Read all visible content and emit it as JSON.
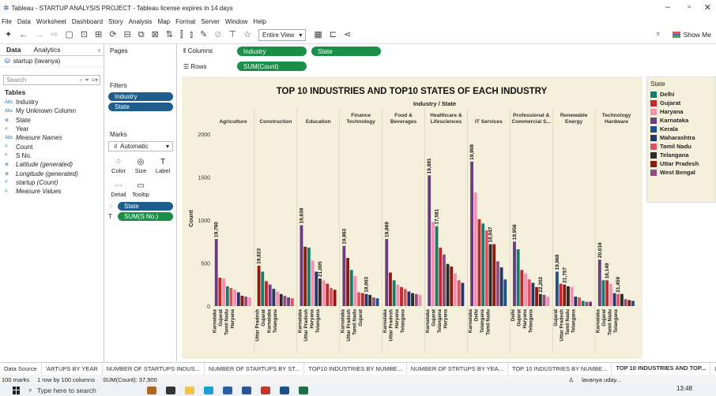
{
  "window": {
    "title": "Tableau - STARTUP ANALYSIS PROJECT - Tableau license expires in 14 days"
  },
  "menu": [
    "File",
    "Data",
    "Worksheet",
    "Dashboard",
    "Story",
    "Analysis",
    "Map",
    "Format",
    "Server",
    "Window",
    "Help"
  ],
  "toolbar": {
    "view_select": "Entire View",
    "show_me": "Show Me"
  },
  "left": {
    "tab_data": "Data",
    "tab_analytics": "Analytics",
    "datasource": "startup (lavanya)",
    "search_placeholder": "Search",
    "tables_header": "Tables",
    "fields": [
      {
        "label": "Industry",
        "kind": "Abc"
      },
      {
        "label": "My Unknown Column",
        "kind": "Abc"
      },
      {
        "label": "State",
        "kind": "geo"
      },
      {
        "label": "Year",
        "kind": "#"
      },
      {
        "label": "Measure Names",
        "kind": "Abc"
      },
      {
        "label": "Count",
        "kind": "#"
      },
      {
        "label": "S No.",
        "kind": "#"
      },
      {
        "label": "Latitude (generated)",
        "kind": "geo"
      },
      {
        "label": "Longitude (generated)",
        "kind": "geo"
      },
      {
        "label": "startup (Count)",
        "kind": "#"
      },
      {
        "label": "Measure Values",
        "kind": "#"
      }
    ]
  },
  "pages": {
    "header": "Pages",
    "filters_header": "Filters",
    "filters": [
      "Industry",
      "State"
    ],
    "marks_header": "Marks",
    "mark_type": "Automatic",
    "mark_buttons": [
      "Color",
      "Size",
      "Label",
      "Detail",
      "Tooltip"
    ],
    "mark_pills": [
      "State",
      "SUM(S No.)"
    ]
  },
  "shelves": {
    "columns_label": "Columns",
    "rows_label": "Rows",
    "columns": [
      "Industry",
      "State"
    ],
    "rows": [
      "SUM(Count)"
    ]
  },
  "legend": {
    "title": "State",
    "items": [
      {
        "label": "Delhi",
        "color": "#1a7a6a"
      },
      {
        "label": "Gujarat",
        "color": "#c1272d"
      },
      {
        "label": "Haryana",
        "color": "#f48fb1"
      },
      {
        "label": "Karnataka",
        "color": "#6a3d7f"
      },
      {
        "label": "Kerala",
        "color": "#1f4e8c"
      },
      {
        "label": "Maharashtra",
        "color": "#23376b"
      },
      {
        "label": "Tamil Nadu",
        "color": "#e05263"
      },
      {
        "label": "Telangana",
        "color": "#2b2b2b"
      },
      {
        "label": "Uttar Pradesh",
        "color": "#8c1c13"
      },
      {
        "label": "West Bengal",
        "color": "#8e4f80"
      }
    ]
  },
  "chart_data": {
    "type": "bar",
    "title": "TOP 10 INDUSTRIES AND TOP10 STATES OF EACH INDUSTRY",
    "column_header": "Industry / State",
    "ylabel": "Count",
    "ylim": [
      0,
      2000
    ],
    "yticks": [
      0,
      500,
      1000,
      1500,
      2000
    ],
    "series": [
      {
        "industry": "Agriculture",
        "bars": [
          {
            "state": "Karnataka",
            "value": 780,
            "label": "19,760"
          },
          {
            "state": "Gujarat",
            "value": 330
          },
          {
            "state": "Haryana",
            "value": 320
          },
          {
            "state": "Delhi",
            "value": 230
          },
          {
            "state": "Tamil Nadu",
            "value": 210
          },
          {
            "state": "Haryana",
            "value": 190
          },
          {
            "state": "Maharashtra",
            "value": 160
          },
          {
            "state": "Uttar Pradesh",
            "value": 120
          },
          {
            "state": "West Bengal",
            "value": 110
          },
          {
            "state": "Haryana",
            "value": 100
          }
        ]
      },
      {
        "industry": "Construction",
        "bars": [
          {
            "state": "Uttar Pradesh",
            "value": 470,
            "label": "19,823"
          },
          {
            "state": "Delhi",
            "value": 400
          },
          {
            "state": "Gujarat",
            "value": 290
          },
          {
            "state": "Karnataka",
            "value": 250
          },
          {
            "state": "Maharashtra",
            "value": 200
          },
          {
            "state": "Haryana",
            "value": 170
          },
          {
            "state": "Telangana",
            "value": 140
          },
          {
            "state": "West Bengal",
            "value": 120
          },
          {
            "state": "Karnataka",
            "value": 100
          },
          {
            "state": "Tamil Nadu",
            "value": 90
          }
        ]
      },
      {
        "industry": "Education",
        "bars": [
          {
            "state": "Karnataka",
            "value": 940,
            "label": "19,839"
          },
          {
            "state": "Uttar Pradesh",
            "value": 690
          },
          {
            "state": "Delhi",
            "value": 680
          },
          {
            "state": "Haryana",
            "value": 530
          },
          {
            "state": "Maharashtra",
            "value": 400
          },
          {
            "state": "Telangana",
            "value": 320,
            "label": "21,005"
          },
          {
            "state": "Haryana",
            "value": 300
          },
          {
            "state": "Gujarat",
            "value": 260
          },
          {
            "state": "Tamil Nadu",
            "value": 210
          },
          {
            "state": "Uttar Pradesh",
            "value": 190
          }
        ]
      },
      {
        "industry": "Finance Technology",
        "bars": [
          {
            "state": "Karnataka",
            "value": 700,
            "label": "19,863"
          },
          {
            "state": "Uttar Pradesh",
            "value": 560
          },
          {
            "state": "Delhi",
            "value": 420
          },
          {
            "state": "Haryana",
            "value": 350
          },
          {
            "state": "Tamil Nadu",
            "value": 160
          },
          {
            "state": "Gujarat",
            "value": 150
          },
          {
            "state": "Maharashtra",
            "value": 140,
            "label": "18,003"
          },
          {
            "state": "Telangana",
            "value": 130
          },
          {
            "state": "West Bengal",
            "value": 100
          },
          {
            "state": "Kerala",
            "value": 90
          }
        ]
      },
      {
        "industry": "Food & Beverages",
        "bars": [
          {
            "state": "Karnataka",
            "value": 780,
            "label": "19,869"
          },
          {
            "state": "Uttar Pradesh",
            "value": 390
          },
          {
            "state": "Delhi",
            "value": 300
          },
          {
            "state": "Haryana",
            "value": 250
          },
          {
            "state": "Gujarat",
            "value": 220
          },
          {
            "state": "Tamil Nadu",
            "value": 200
          },
          {
            "state": "Maharashtra",
            "value": 170
          },
          {
            "state": "Telangana",
            "value": 150
          },
          {
            "state": "West Bengal",
            "value": 140
          },
          {
            "state": "Haryana",
            "value": 130
          }
        ]
      },
      {
        "industry": "Healthcare & Lifesciences",
        "bars": [
          {
            "state": "Karnataka",
            "value": 1520,
            "label": "19,881"
          },
          {
            "state": "Haryana",
            "value": 980
          },
          {
            "state": "Delhi",
            "value": 930,
            "label": "17,581"
          },
          {
            "state": "Gujarat",
            "value": 680
          },
          {
            "state": "West Bengal",
            "value": 600
          },
          {
            "state": "Telangana",
            "value": 490
          },
          {
            "state": "Uttar Pradesh",
            "value": 460
          },
          {
            "state": "Haryana",
            "value": 380
          },
          {
            "state": "Tamil Nadu",
            "value": 300
          },
          {
            "state": "Maharashtra",
            "value": 270
          }
        ]
      },
      {
        "industry": "IT Services",
        "bars": [
          {
            "state": "Karnataka",
            "value": 1680,
            "label": "19,908"
          },
          {
            "state": "Haryana",
            "value": 1320
          },
          {
            "state": "Gujarat",
            "value": 1010
          },
          {
            "state": "Delhi",
            "value": 960
          },
          {
            "state": "Tamil Nadu",
            "value": 880
          },
          {
            "state": "Telangana",
            "value": 720,
            "label": "18,047"
          },
          {
            "state": "Uttar Pradesh",
            "value": 720
          },
          {
            "state": "West Bengal",
            "value": 520
          },
          {
            "state": "Maharashtra",
            "value": 450
          },
          {
            "state": "Kerala",
            "value": 310
          }
        ]
      },
      {
        "industry": "Professional & Commercial S...",
        "bars": [
          {
            "state": "Karnataka",
            "value": 750,
            "label": "19,956"
          },
          {
            "state": "Delhi",
            "value": 660
          },
          {
            "state": "Gujarat",
            "value": 420
          },
          {
            "state": "Haryana",
            "value": 380
          },
          {
            "state": "Tamil Nadu",
            "value": 310
          },
          {
            "state": "Maharashtra",
            "value": 270
          },
          {
            "state": "Uttar Pradesh",
            "value": 220
          },
          {
            "state": "Telangana",
            "value": 140,
            "label": "22,202"
          },
          {
            "state": "West Bengal",
            "value": 130
          },
          {
            "state": "Haryana",
            "value": 110
          }
        ]
      },
      {
        "industry": "Renewable Energy",
        "bars": [
          {
            "state": "Kerala",
            "value": 400,
            "label": "19,968"
          },
          {
            "state": "Gujarat",
            "value": 260
          },
          {
            "state": "Uttar Pradesh",
            "value": 250,
            "label": "21,757"
          },
          {
            "state": "Telangana",
            "value": 230
          },
          {
            "state": "Haryana",
            "value": 220
          },
          {
            "state": "Maharashtra",
            "value": 110
          },
          {
            "state": "Tamil Nadu",
            "value": 100
          },
          {
            "state": "Delhi",
            "value": 60
          },
          {
            "state": "West Bengal",
            "value": 50
          },
          {
            "state": "Karnataka",
            "value": 50
          }
        ]
      },
      {
        "industry": "Technology Hardware",
        "bars": [
          {
            "state": "Karnataka",
            "value": 540,
            "label": "20,016"
          },
          {
            "state": "Delhi",
            "value": 300
          },
          {
            "state": "Gujarat",
            "value": 300,
            "label": "18,149"
          },
          {
            "state": "Haryana",
            "value": 260
          },
          {
            "state": "Maharashtra",
            "value": 150
          },
          {
            "state": "Tamil Nadu",
            "value": 140,
            "label": "21,459"
          },
          {
            "state": "Telangana",
            "value": 140
          },
          {
            "state": "West Bengal",
            "value": 80
          },
          {
            "state": "Uttar Pradesh",
            "value": 70
          },
          {
            "state": "Kerala",
            "value": 60
          }
        ]
      }
    ],
    "axis_labels": [
      [
        "Karnataka",
        "Gujarat",
        "Tamil Nadu",
        "Haryana"
      ],
      [
        "Uttar Pradesh",
        "Gujarat",
        "Karnataka",
        "Telangana"
      ],
      [
        "Karnataka",
        "Uttar Pradesh",
        "Haryana",
        "Telangana"
      ],
      [
        "Karnataka",
        "Uttar Pradesh",
        "Tamil Nadu",
        "Gujarat"
      ],
      [
        "Karnataka",
        "Uttar Pradesh",
        "Haryana",
        "Telangana"
      ],
      [
        "Karnataka",
        "Gujarat",
        "Telangana",
        "Haryana"
      ],
      [
        "Karnataka",
        "Delhi",
        "Telangana",
        "Tamil Nadu"
      ],
      [
        "Delhi",
        "Gujarat",
        "Haryana",
        "Telangana"
      ],
      [
        "Gujarat",
        "Uttar Pradesh",
        "Tamil Nadu",
        "Telangana"
      ],
      [
        "Karnataka",
        "Gujarat",
        "Tamil Nadu",
        "Telangana"
      ]
    ]
  },
  "sheet_tabs": [
    "Data Source",
    "'ARTUPS BY YEAR",
    "NUMBER OF STARTUPS INDUS...",
    "NUMBER OF STARTUPS BY ST...",
    "TOP10 INDUSTRIES BY NUMBE...",
    "NUMBER OF STRTUPS BY YEA...",
    "TOP 10 INDUSTRIES BY NUMBE...",
    "TOP 10 INDUSTRIES AND TOP..."
  ],
  "status": {
    "marks": "100 marks",
    "dims": "1 row by 100 columns",
    "sum": "SUM(Count): 37,900",
    "user": "lavanya uday..."
  },
  "taskbar": {
    "search": "Type here to search",
    "time": "13:48"
  }
}
